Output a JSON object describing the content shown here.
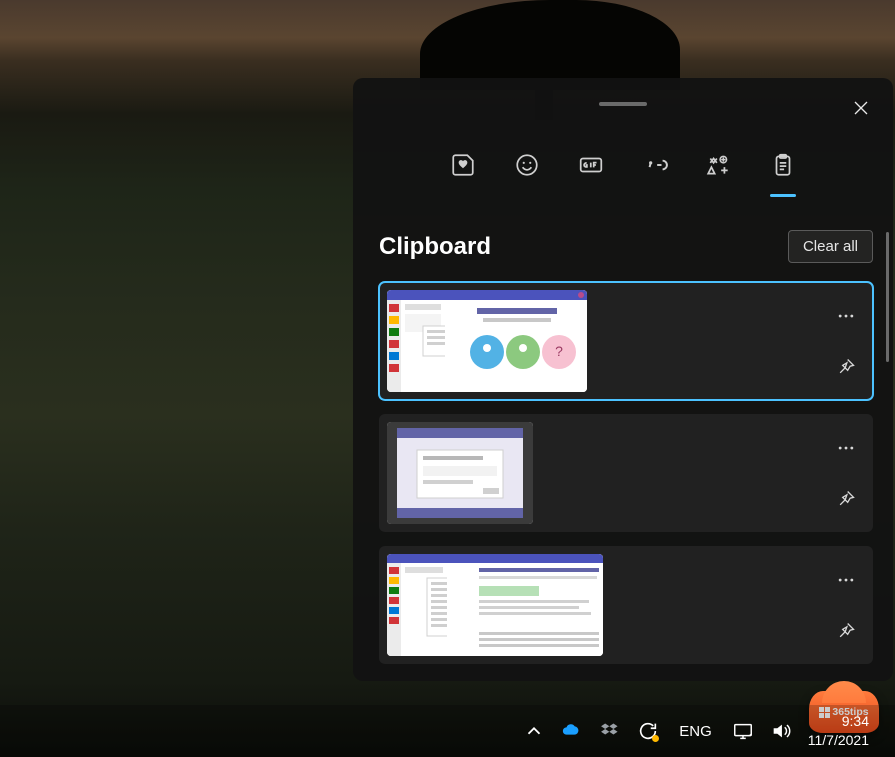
{
  "panel": {
    "title": "Clipboard",
    "clear_all_label": "Clear all",
    "tabs": [
      "favorites",
      "emoji",
      "gif",
      "kaomoji",
      "symbols",
      "clipboard"
    ],
    "active_tab_index": 5,
    "items": [
      {
        "selected": true,
        "thumb_kind": "teams-welcome"
      },
      {
        "selected": false,
        "thumb_kind": "teams-dialog"
      },
      {
        "selected": false,
        "thumb_kind": "teams-menu"
      }
    ]
  },
  "taskbar": {
    "language": "ENG",
    "time": "9:34",
    "date": "11/7/2021"
  },
  "watermark": {
    "text": "365tips"
  }
}
